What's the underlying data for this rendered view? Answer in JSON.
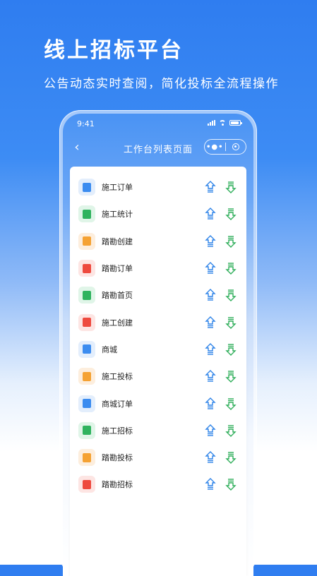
{
  "headline": "线上招标平台",
  "subline": "公告动态实时查阅，简化投标全流程操作",
  "status": {
    "time": "9:41"
  },
  "navbar": {
    "title": "工作台列表页面",
    "back_icon": "chevron-left-icon",
    "more_label": "•●•"
  },
  "colors": {
    "up_arrow": "#2f84e8",
    "down_arrow": "#2fae5a",
    "card_bg": "#ffffff"
  },
  "items": [
    {
      "label": "施工订单",
      "icon": "clipboard-check-icon",
      "bg": "#e3eefc",
      "fg": "#3b8cf0"
    },
    {
      "label": "施工统计",
      "icon": "document-chart-icon",
      "bg": "#e0f5e8",
      "fg": "#2fb35e"
    },
    {
      "label": "踏勘创建",
      "icon": "funnel-icon",
      "bg": "#fdeedd",
      "fg": "#f5a233"
    },
    {
      "label": "踏勘订单",
      "icon": "clipboard-list-icon",
      "bg": "#fde5e3",
      "fg": "#ee4a3e"
    },
    {
      "label": "踏勘首页",
      "icon": "monitor-icon",
      "bg": "#e0f5e8",
      "fg": "#2fb35e"
    },
    {
      "label": "施工创建",
      "icon": "add-document-icon",
      "bg": "#fde5e3",
      "fg": "#ee4a3e"
    },
    {
      "label": "商城",
      "icon": "shopping-bag-icon",
      "bg": "#e3eefc",
      "fg": "#3b8cf0"
    },
    {
      "label": "施工投标",
      "icon": "auction-coin-icon",
      "bg": "#fdeedd",
      "fg": "#f5a233"
    },
    {
      "label": "商城订单",
      "icon": "receipt-icon",
      "bg": "#e3eefc",
      "fg": "#3b8cf0"
    },
    {
      "label": "施工招标",
      "icon": "paper-plane-icon",
      "bg": "#e0f5e8",
      "fg": "#2fb35e"
    },
    {
      "label": "踏勘投标",
      "icon": "gavel-icon",
      "bg": "#fdeedd",
      "fg": "#f5a233"
    },
    {
      "label": "踏勘招标",
      "icon": "target-icon",
      "bg": "#fde5e3",
      "fg": "#ee4a3e"
    }
  ]
}
